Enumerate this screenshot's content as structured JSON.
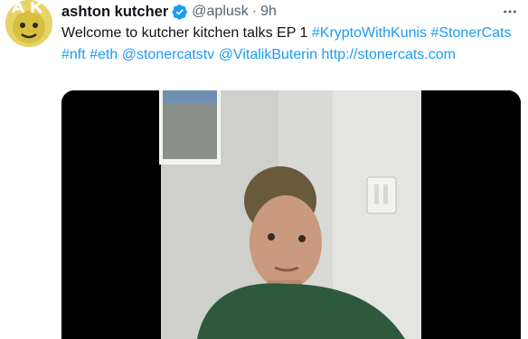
{
  "tweet": {
    "author_name": "ashton kutcher",
    "handle": "@aplusk",
    "separator": "·",
    "time": "9h",
    "text_plain": "Welcome to kutcher kitchen talks EP 1 ",
    "links": [
      "#KryptoWithKunis",
      "#StonerCats",
      "#nft",
      "#eth",
      "@stonercatstv",
      "@VitalikButerin",
      "http://stonercats.com"
    ]
  },
  "avatar": {
    "initials": "AK"
  },
  "icons": {
    "verified": "verified-badge-icon",
    "more": "more-options-icon"
  },
  "colors": {
    "link": "#1d9bf0",
    "verified": "#1d9bf0",
    "avatar_bg": "#e6d36a",
    "video_bg": "#000000"
  }
}
